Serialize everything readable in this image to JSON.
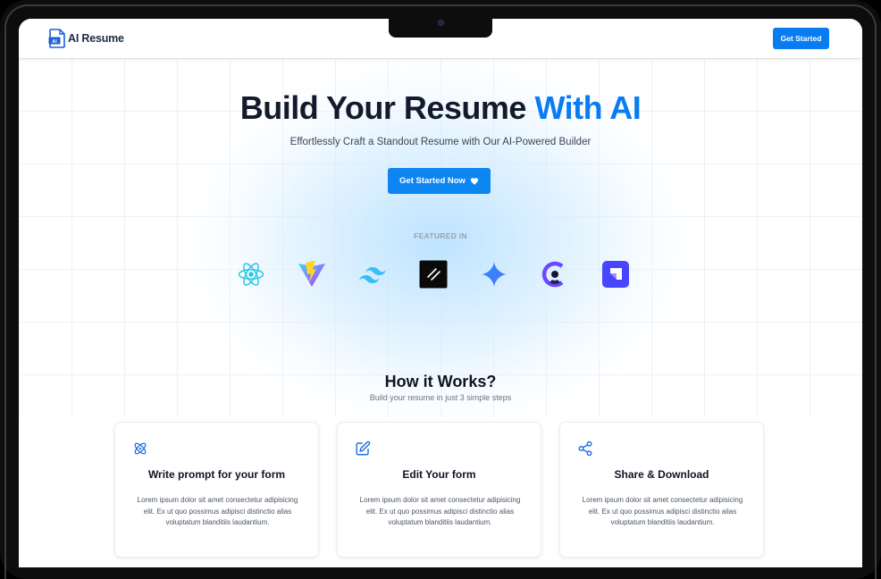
{
  "nav": {
    "brand": "AI Resume",
    "brand_badge": "AI",
    "cta_label": "Get Started"
  },
  "hero": {
    "title_main": "Build Your Resume ",
    "title_accent": "With AI",
    "subtitle": "Effortlessly Craft a Standout Resume with Our AI-Powered Builder",
    "cta_label": "Get Started Now",
    "featured_label": "FEATURED IN",
    "tech_logos": [
      "react-icon",
      "vite-icon",
      "tailwind-icon",
      "shadcn-icon",
      "gemini-icon",
      "clerk-icon",
      "strapi-icon"
    ]
  },
  "how": {
    "title": "How it Works?",
    "subtitle": "Build your resume in just 3 simple steps",
    "cards": [
      {
        "icon": "atom-icon",
        "title": "Write prompt for your form",
        "text": "Lorem ipsum dolor sit amet consectetur adipisicing elit. Ex ut quo possimus adipisci distinctio alias voluptatum blanditiis laudantium."
      },
      {
        "icon": "edit-icon",
        "title": "Edit Your form",
        "text": "Lorem ipsum dolor sit amet consectetur adipisicing elit. Ex ut quo possimus adipisci distinctio alias voluptatum blanditiis laudantium."
      },
      {
        "icon": "share-icon",
        "title": "Share & Download",
        "text": "Lorem ipsum dolor sit amet consectetur adipisicing elit. Ex ut quo possimus adipisci distinctio alias voluptatum blanditiis laudantium."
      }
    ]
  },
  "colors": {
    "accent": "#0a7cf2",
    "heading": "#131a2b",
    "device_frame": "#0d0d0d"
  }
}
